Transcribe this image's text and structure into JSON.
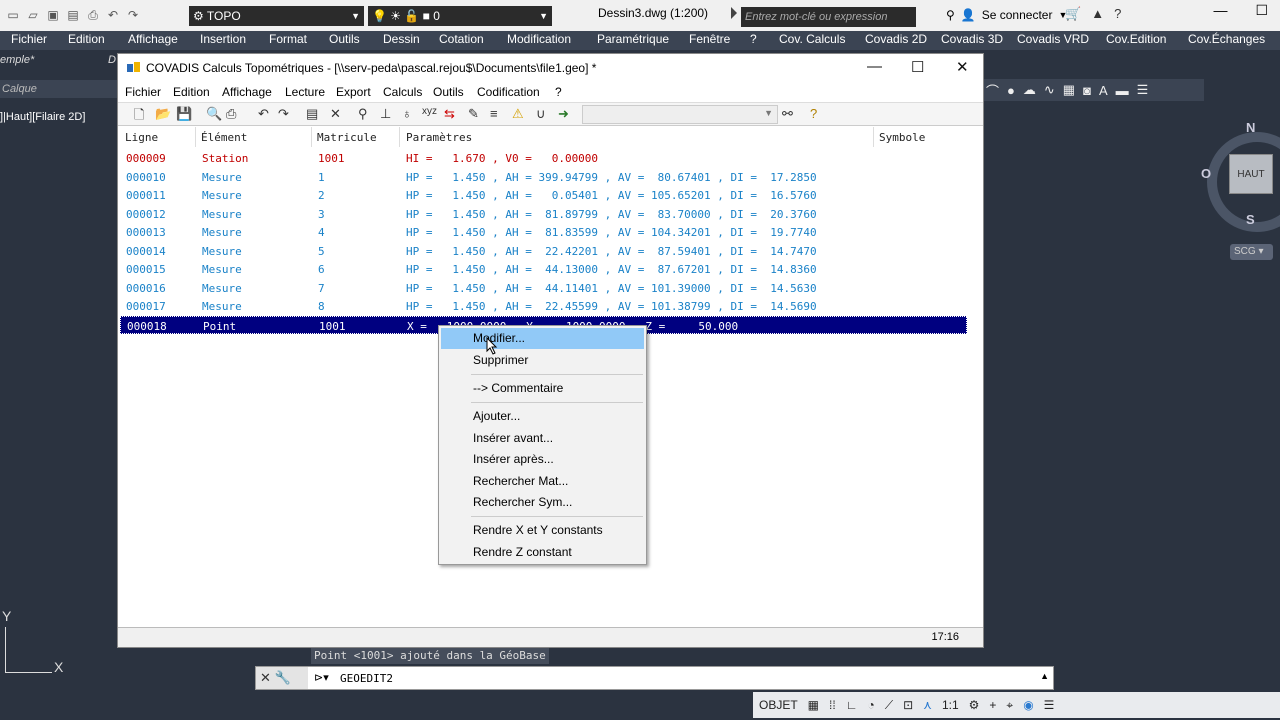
{
  "acad": {
    "workspace": "TOPO",
    "layer": "0",
    "doc_title": "Dessin3.dwg (1:200)",
    "search_placeholder": "Entrez mot-clé ou expression",
    "signin": "Se connecter",
    "menu": [
      "Fichier",
      "Edition",
      "Affichage",
      "Insertion",
      "Format",
      "Outils",
      "Dessin",
      "Cotation",
      "Modification",
      "Paramétrique",
      "Fenêtre",
      "?",
      "Cov. Calculs",
      "Covadis 2D",
      "Covadis 3D",
      "Covadis VRD",
      "Cov.Edition",
      "Cov.Échanges"
    ],
    "doc_tab": "emple*",
    "doc_tab2": "D",
    "layer_ribbon": "Calque",
    "viewport_label": "]|Haut][Filaire 2D]",
    "viewcube": {
      "face": "HAUT",
      "n": "N",
      "s": "S",
      "w": "O"
    },
    "scg": "SCG",
    "ucs_x": "X",
    "ucs_y": "Y",
    "cmd_history": "Point <1001> ajouté dans la GéoBase",
    "cmd_current": "GEOEDIT2",
    "status": {
      "objet": "OBJET",
      "scale": "1:1"
    }
  },
  "dialog": {
    "title": "COVADIS Calculs Topométriques - [\\\\serv-peda\\pascal.rejou$\\Documents\\file1.geo] *",
    "menu": [
      "Fichier",
      "Edition",
      "Affichage",
      "Lecture",
      "Export",
      "Calculs",
      "Outils",
      "Codification",
      "?"
    ],
    "columns": [
      "Ligne",
      "Élément",
      "Matricule",
      "Paramètres",
      "Symbole"
    ],
    "rows": [
      {
        "ligne": "000009",
        "element": "Station",
        "matricule": "1001",
        "params": "HI =   1.670 , V0 =   0.00000",
        "kind": "red"
      },
      {
        "ligne": "000010",
        "element": "Mesure",
        "matricule": "1",
        "params": "HP =   1.450 , AH = 399.94799 , AV =  80.67401 , DI =  17.2850",
        "kind": "blue"
      },
      {
        "ligne": "000011",
        "element": "Mesure",
        "matricule": "2",
        "params": "HP =   1.450 , AH =   0.05401 , AV = 105.65201 , DI =  16.5760",
        "kind": "blue"
      },
      {
        "ligne": "000012",
        "element": "Mesure",
        "matricule": "3",
        "params": "HP =   1.450 , AH =  81.89799 , AV =  83.70000 , DI =  20.3760",
        "kind": "blue"
      },
      {
        "ligne": "000013",
        "element": "Mesure",
        "matricule": "4",
        "params": "HP =   1.450 , AH =  81.83599 , AV = 104.34201 , DI =  19.7740",
        "kind": "blue"
      },
      {
        "ligne": "000014",
        "element": "Mesure",
        "matricule": "5",
        "params": "HP =   1.450 , AH =  22.42201 , AV =  87.59401 , DI =  14.7470",
        "kind": "blue"
      },
      {
        "ligne": "000015",
        "element": "Mesure",
        "matricule": "6",
        "params": "HP =   1.450 , AH =  44.13000 , AV =  87.67201 , DI =  14.8360",
        "kind": "blue"
      },
      {
        "ligne": "000016",
        "element": "Mesure",
        "matricule": "7",
        "params": "HP =   1.450 , AH =  44.11401 , AV = 101.39000 , DI =  14.5630",
        "kind": "blue"
      },
      {
        "ligne": "000017",
        "element": "Mesure",
        "matricule": "8",
        "params": "HP =   1.450 , AH =  22.45599 , AV = 101.38799 , DI =  14.5690",
        "kind": "blue"
      },
      {
        "ligne": "000018",
        "element": "Point",
        "matricule": "1001",
        "params": "X =   1000.0000 , Y =   1000.0000 , Z =     50.000",
        "kind": "sel"
      }
    ],
    "status_time": "17:16"
  },
  "context_menu": {
    "items": [
      "Modifier...",
      "Supprimer",
      "--> Commentaire",
      "Ajouter...",
      "Insérer avant...",
      "Insérer après...",
      "Rechercher Mat...",
      "Rechercher Sym...",
      "Rendre X et Y constants",
      "Rendre Z constant"
    ],
    "highlighted": "Modifier..."
  }
}
